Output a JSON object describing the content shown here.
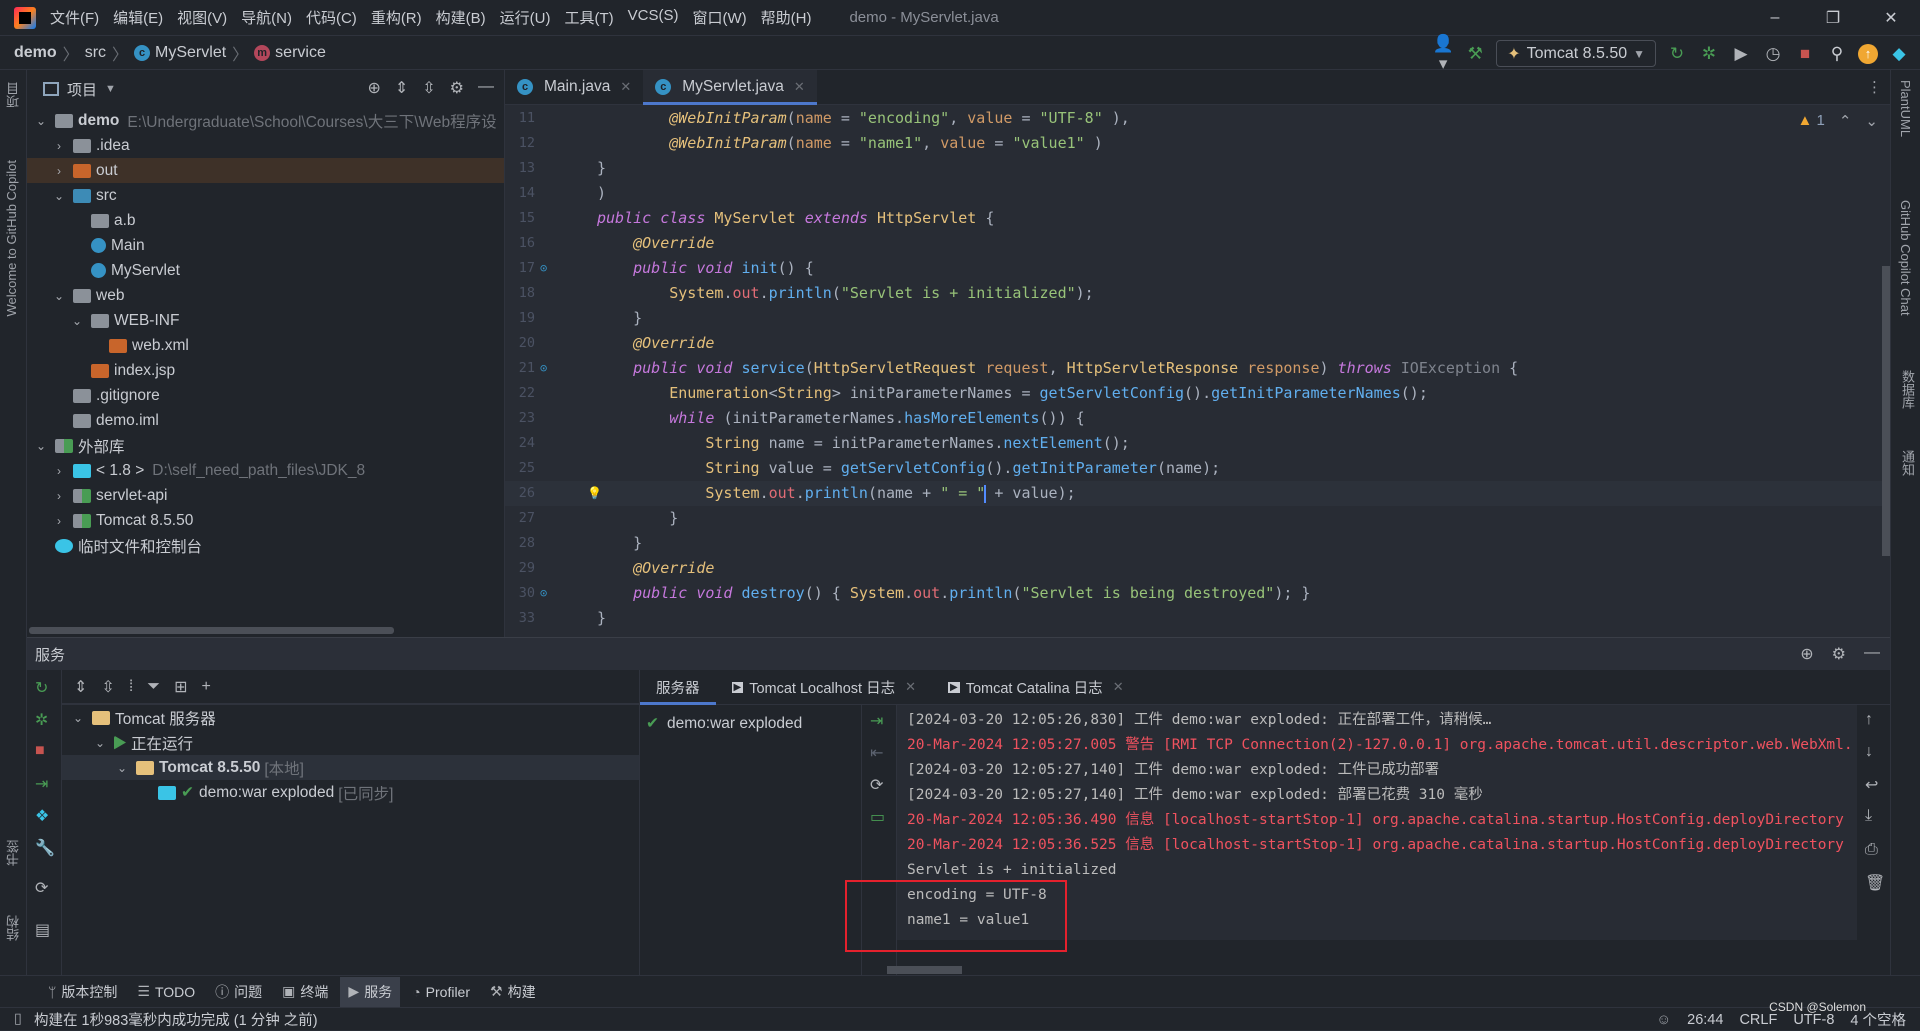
{
  "titlebar": {
    "menu": [
      "文件(F)",
      "编辑(E)",
      "视图(V)",
      "导航(N)",
      "代码(C)",
      "重构(R)",
      "构建(B)",
      "运行(U)",
      "工具(T)",
      "VCS(S)",
      "窗口(W)",
      "帮助(H)"
    ],
    "title": "demo - MyServlet.java",
    "minimize": "–",
    "restore": "❐",
    "close": "✕"
  },
  "breadcrumb": {
    "project": "demo",
    "folder": "src",
    "class": "MyServlet",
    "method": "service"
  },
  "toolbar": {
    "run_config": "Tomcat 8.5.50",
    "colors": {
      "run": "#499c54",
      "stop": "#c75450",
      "update": "#f0a732"
    }
  },
  "left_strip": {
    "project": "项目",
    "copilot": "Welcome to GitHub Copilot",
    "bookmarks": "书签",
    "structure": "结构"
  },
  "right_strip": {
    "plantuml": "PlantUML",
    "copilot_chat": "GitHub Copilot Chat",
    "database": "数据库",
    "notifications": "通知"
  },
  "project_panel": {
    "title": "项目",
    "tree": [
      {
        "label": "demo",
        "hint": "E:\\Undergraduate\\School\\Courses\\大三下\\Web程序设",
        "depth": 0,
        "arrow": "v",
        "icon": "module-folder",
        "bold": true
      },
      {
        "label": ".idea",
        "depth": 1,
        "arrow": ">",
        "icon": "folder"
      },
      {
        "label": "out",
        "depth": 1,
        "arrow": ">",
        "icon": "excluded-folder",
        "selected": true
      },
      {
        "label": "src",
        "depth": 1,
        "arrow": "v",
        "icon": "source-folder"
      },
      {
        "label": "a.b",
        "depth": 2,
        "icon": "package"
      },
      {
        "label": "Main",
        "depth": 2,
        "icon": "class-main"
      },
      {
        "label": "MyServlet",
        "depth": 2,
        "icon": "class"
      },
      {
        "label": "web",
        "depth": 1,
        "arrow": "v",
        "icon": "web-folder"
      },
      {
        "label": "WEB-INF",
        "depth": 2,
        "arrow": "v",
        "icon": "folder"
      },
      {
        "label": "web.xml",
        "depth": 3,
        "icon": "xml-file"
      },
      {
        "label": "index.jsp",
        "depth": 2,
        "icon": "jsp-file"
      },
      {
        "label": ".gitignore",
        "depth": 1,
        "icon": "ignore-file"
      },
      {
        "label": "demo.iml",
        "depth": 1,
        "icon": "iml-file"
      },
      {
        "label": "外部库",
        "depth": 0,
        "arrow": "v",
        "icon": "library"
      },
      {
        "label": "< 1.8 >",
        "hint": "D:\\self_need_path_files\\JDK_8",
        "depth": 1,
        "arrow": ">",
        "icon": "jdk"
      },
      {
        "label": "servlet-api",
        "depth": 1,
        "arrow": ">",
        "icon": "library"
      },
      {
        "label": "Tomcat 8.5.50",
        "depth": 1,
        "arrow": ">",
        "icon": "library"
      },
      {
        "label": "临时文件和控制台",
        "depth": 0,
        "icon": "scratches"
      }
    ]
  },
  "editor": {
    "tabs": [
      {
        "label": "Main.java",
        "active": false
      },
      {
        "label": "MyServlet.java",
        "active": true
      }
    ],
    "warnings": "1",
    "lines": [
      {
        "n": "11",
        "t": [
          [
            "        ",
            "plain"
          ],
          [
            "@WebInitParam",
            "an"
          ],
          [
            "(",
            "plain"
          ],
          [
            "name",
            "pa"
          ],
          [
            " = ",
            "plain"
          ],
          [
            "\"encoding\"",
            "st"
          ],
          [
            ", ",
            "plain"
          ],
          [
            "value",
            "pa"
          ],
          [
            " = ",
            "plain"
          ],
          [
            "\"UTF-8\"",
            "st"
          ],
          [
            " ),",
            "plain"
          ]
        ]
      },
      {
        "n": "12",
        "t": [
          [
            "        ",
            "plain"
          ],
          [
            "@WebInitParam",
            "an"
          ],
          [
            "(",
            "plain"
          ],
          [
            "name",
            "pa"
          ],
          [
            " = ",
            "plain"
          ],
          [
            "\"name1\"",
            "st"
          ],
          [
            ", ",
            "plain"
          ],
          [
            "value",
            "pa"
          ],
          [
            " = ",
            "plain"
          ],
          [
            "\"value1\"",
            "st"
          ],
          [
            " )",
            "plain"
          ]
        ]
      },
      {
        "n": "13",
        "t": [
          [
            "}",
            "plain"
          ]
        ]
      },
      {
        "n": "14",
        "t": [
          [
            ")",
            "plain"
          ]
        ]
      },
      {
        "n": "15",
        "t": [
          [
            "public ",
            "kw"
          ],
          [
            "class ",
            "kw"
          ],
          [
            "MyServlet ",
            "ty"
          ],
          [
            "extends ",
            "kw"
          ],
          [
            "HttpServlet",
            "ty"
          ],
          [
            " {",
            "plain"
          ]
        ]
      },
      {
        "n": "16",
        "t": [
          [
            "    ",
            "plain"
          ],
          [
            "@Override",
            "an"
          ]
        ]
      },
      {
        "n": "17",
        "t": [
          [
            "    ",
            "plain"
          ],
          [
            "public ",
            "kw"
          ],
          [
            "void ",
            "kw"
          ],
          [
            "init",
            "fn"
          ],
          [
            "() {",
            "plain"
          ]
        ],
        "gutter": "override"
      },
      {
        "n": "18",
        "t": [
          [
            "        ",
            "plain"
          ],
          [
            "System",
            "ty"
          ],
          [
            ".",
            "plain"
          ],
          [
            "out",
            "fd"
          ],
          [
            ".",
            "plain"
          ],
          [
            "println",
            "fn"
          ],
          [
            "(",
            "plain"
          ],
          [
            "\"Servlet is + initialized\"",
            "st"
          ],
          [
            ");",
            "plain"
          ]
        ]
      },
      {
        "n": "19",
        "t": [
          [
            "    }",
            "plain"
          ]
        ]
      },
      {
        "n": "20",
        "t": [
          [
            "    ",
            "plain"
          ],
          [
            "@Override",
            "an"
          ]
        ]
      },
      {
        "n": "21",
        "t": [
          [
            "    ",
            "plain"
          ],
          [
            "public ",
            "kw"
          ],
          [
            "void ",
            "kw"
          ],
          [
            "service",
            "fn"
          ],
          [
            "(",
            "plain"
          ],
          [
            "HttpServletRequest ",
            "ty"
          ],
          [
            "request",
            "pa"
          ],
          [
            ", ",
            "plain"
          ],
          [
            "HttpServletResponse ",
            "ty"
          ],
          [
            "response",
            "pa"
          ],
          [
            ") ",
            "plain"
          ],
          [
            "throws ",
            "kw"
          ],
          [
            "IOException",
            "dim"
          ],
          [
            " {",
            "plain"
          ]
        ],
        "gutter": "override"
      },
      {
        "n": "22",
        "t": [
          [
            "        ",
            "plain"
          ],
          [
            "Enumeration",
            "ty"
          ],
          [
            "<",
            "plain"
          ],
          [
            "String",
            "ty"
          ],
          [
            "> initParameterNames = ",
            "plain"
          ],
          [
            "getServletConfig",
            "fn"
          ],
          [
            "().",
            "plain"
          ],
          [
            "getInitParameterNames",
            "fn"
          ],
          [
            "();",
            "plain"
          ]
        ]
      },
      {
        "n": "23",
        "t": [
          [
            "        ",
            "plain"
          ],
          [
            "while ",
            "kw"
          ],
          [
            "(initParameterNames.",
            "plain"
          ],
          [
            "hasMoreElements",
            "fn"
          ],
          [
            "()) {",
            "plain"
          ]
        ]
      },
      {
        "n": "24",
        "t": [
          [
            "            ",
            "plain"
          ],
          [
            "String ",
            "ty"
          ],
          [
            "name = initParameterNames.",
            "plain"
          ],
          [
            "nextElement",
            "fn"
          ],
          [
            "();",
            "plain"
          ]
        ]
      },
      {
        "n": "25",
        "t": [
          [
            "            ",
            "plain"
          ],
          [
            "String ",
            "ty"
          ],
          [
            "value = ",
            "plain"
          ],
          [
            "getServletConfig",
            "fn"
          ],
          [
            "().",
            "plain"
          ],
          [
            "getInitParameter",
            "fn"
          ],
          [
            "(name);",
            "plain"
          ]
        ]
      },
      {
        "n": "26",
        "t": [
          [
            "            ",
            "plain"
          ],
          [
            "System",
            "ty"
          ],
          [
            ".",
            "plain"
          ],
          [
            "out",
            "fd"
          ],
          [
            ".",
            "plain"
          ],
          [
            "println",
            "fn"
          ],
          [
            "(name + ",
            "plain"
          ],
          [
            "\" = \"",
            "st"
          ],
          [
            "|caret|",
            "caret"
          ],
          [
            " + value);",
            "plain"
          ]
        ],
        "current": true,
        "gutter": "bulb"
      },
      {
        "n": "27",
        "t": [
          [
            "        }",
            "plain"
          ]
        ]
      },
      {
        "n": "28",
        "t": [
          [
            "    }",
            "plain"
          ]
        ]
      },
      {
        "n": "29",
        "t": [
          [
            "    ",
            "plain"
          ],
          [
            "@Override",
            "an"
          ]
        ]
      },
      {
        "n": "30",
        "t": [
          [
            "    ",
            "plain"
          ],
          [
            "public ",
            "kw"
          ],
          [
            "void ",
            "kw"
          ],
          [
            "destroy",
            "fn"
          ],
          [
            "() { ",
            "plain"
          ],
          [
            "System",
            "ty"
          ],
          [
            ".",
            "plain"
          ],
          [
            "out",
            "fd"
          ],
          [
            ".",
            "plain"
          ],
          [
            "println",
            "fn"
          ],
          [
            "(",
            "plain"
          ],
          [
            "\"Servlet is being destroyed\"",
            "st"
          ],
          [
            "); }",
            "plain"
          ]
        ],
        "gutter": "override"
      },
      {
        "n": "33",
        "t": [
          [
            "}",
            "plain"
          ]
        ]
      }
    ]
  },
  "services": {
    "title": "服务",
    "tree": [
      {
        "label": "Tomcat 服务器",
        "depth": 0,
        "arrow": "v",
        "icon": "tomcat"
      },
      {
        "label": "正在运行",
        "depth": 1,
        "arrow": "v",
        "icon": "run"
      },
      {
        "label": "Tomcat 8.5.50",
        "hint": "[本地]",
        "depth": 2,
        "arrow": "v",
        "icon": "tomcat",
        "bold": true,
        "selected": true
      },
      {
        "label": "demo:war exploded",
        "hint": "[已同步]",
        "depth": 3,
        "icon": "artifact-ok"
      }
    ],
    "tabs": [
      {
        "label": "服务器",
        "active": true
      },
      {
        "label": "Tomcat Localhost 日志"
      },
      {
        "label": "Tomcat Catalina 日志"
      }
    ],
    "deployments": [
      "demo:war exploded"
    ],
    "console": [
      {
        "text": "[2024-03-20 12:05:26,830] 工件 demo:war exploded: 正在部署工件，请稍候…",
        "level": "info"
      },
      {
        "text": "20-Mar-2024 12:05:27.005 警告 [RMI TCP Connection(2)-127.0.0.1] org.apache.tomcat.util.descriptor.web.WebXml.",
        "level": "warn"
      },
      {
        "text": "[2024-03-20 12:05:27,140] 工件 demo:war exploded: 工件已成功部署",
        "level": "info"
      },
      {
        "text": "[2024-03-20 12:05:27,140] 工件 demo:war exploded: 部署已花费 310 毫秒",
        "level": "info"
      },
      {
        "text": "20-Mar-2024 12:05:36.490 信息 [localhost-startStop-1] org.apache.catalina.startup.HostConfig.deployDirectory",
        "level": "warn"
      },
      {
        "text": "20-Mar-2024 12:05:36.525 信息 [localhost-startStop-1] org.apache.catalina.startup.HostConfig.deployDirectory",
        "level": "warn"
      },
      {
        "text": "Servlet is + initialized",
        "level": "info"
      },
      {
        "text": "encoding = UTF-8",
        "level": "info"
      },
      {
        "text": "name1 = value1",
        "level": "info"
      }
    ]
  },
  "bottom_tools": [
    {
      "label": "版本控制",
      "icon": "vcs-icon"
    },
    {
      "label": "TODO",
      "icon": "todo-icon"
    },
    {
      "label": "问题",
      "icon": "problems-icon"
    },
    {
      "label": "终端",
      "icon": "terminal-icon"
    },
    {
      "label": "服务",
      "icon": "services-icon",
      "active": true
    },
    {
      "label": "Profiler",
      "icon": "profiler-icon"
    },
    {
      "label": "构建",
      "icon": "build-icon"
    }
  ],
  "status": {
    "message": "构建在 1秒983毫秒内成功完成 (1 分钟 之前)",
    "position": "26:44",
    "line_sep": "CRLF",
    "encoding": "UTF-8",
    "indent": "4 个空格",
    "watermark": "CSDN @Solemon"
  }
}
